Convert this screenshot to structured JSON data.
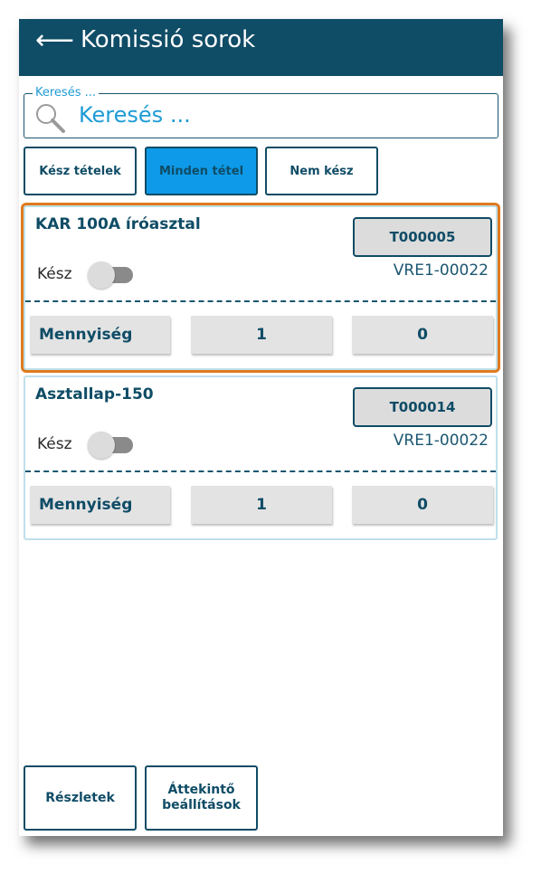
{
  "header": {
    "back_icon": "arrow-left-icon",
    "back_glyph": "⟵",
    "title": "Komissió sorok"
  },
  "search": {
    "legend": "Keresés ...",
    "placeholder": "Keresés ...",
    "icon": "search-icon"
  },
  "filters": [
    {
      "label": "Kész tételek",
      "active": false
    },
    {
      "label": "Minden tétel",
      "active": true
    },
    {
      "label": "Nem kész",
      "active": false
    }
  ],
  "items": [
    {
      "title": "KAR 100A íróasztal",
      "code": "T000005",
      "ref": "VRE1-00022",
      "done_label": "Kész",
      "done": false,
      "qty_label": "Mennyiség",
      "qty": "1",
      "done_qty": "0",
      "selected": true
    },
    {
      "title": "Asztallap-150",
      "code": "T000014",
      "ref": "VRE1-00022",
      "done_label": "Kész",
      "done": false,
      "qty_label": "Mennyiség",
      "qty": "1",
      "done_qty": "0",
      "selected": false
    }
  ],
  "footer": {
    "details_label": "Részletek",
    "overview_label": "Áttekintő\nbeállítások"
  },
  "colors": {
    "primary": "#0f4c66",
    "accent": "#0e9ae8",
    "search_text": "#1e9bd6",
    "selected_border": "#e07a1f"
  }
}
